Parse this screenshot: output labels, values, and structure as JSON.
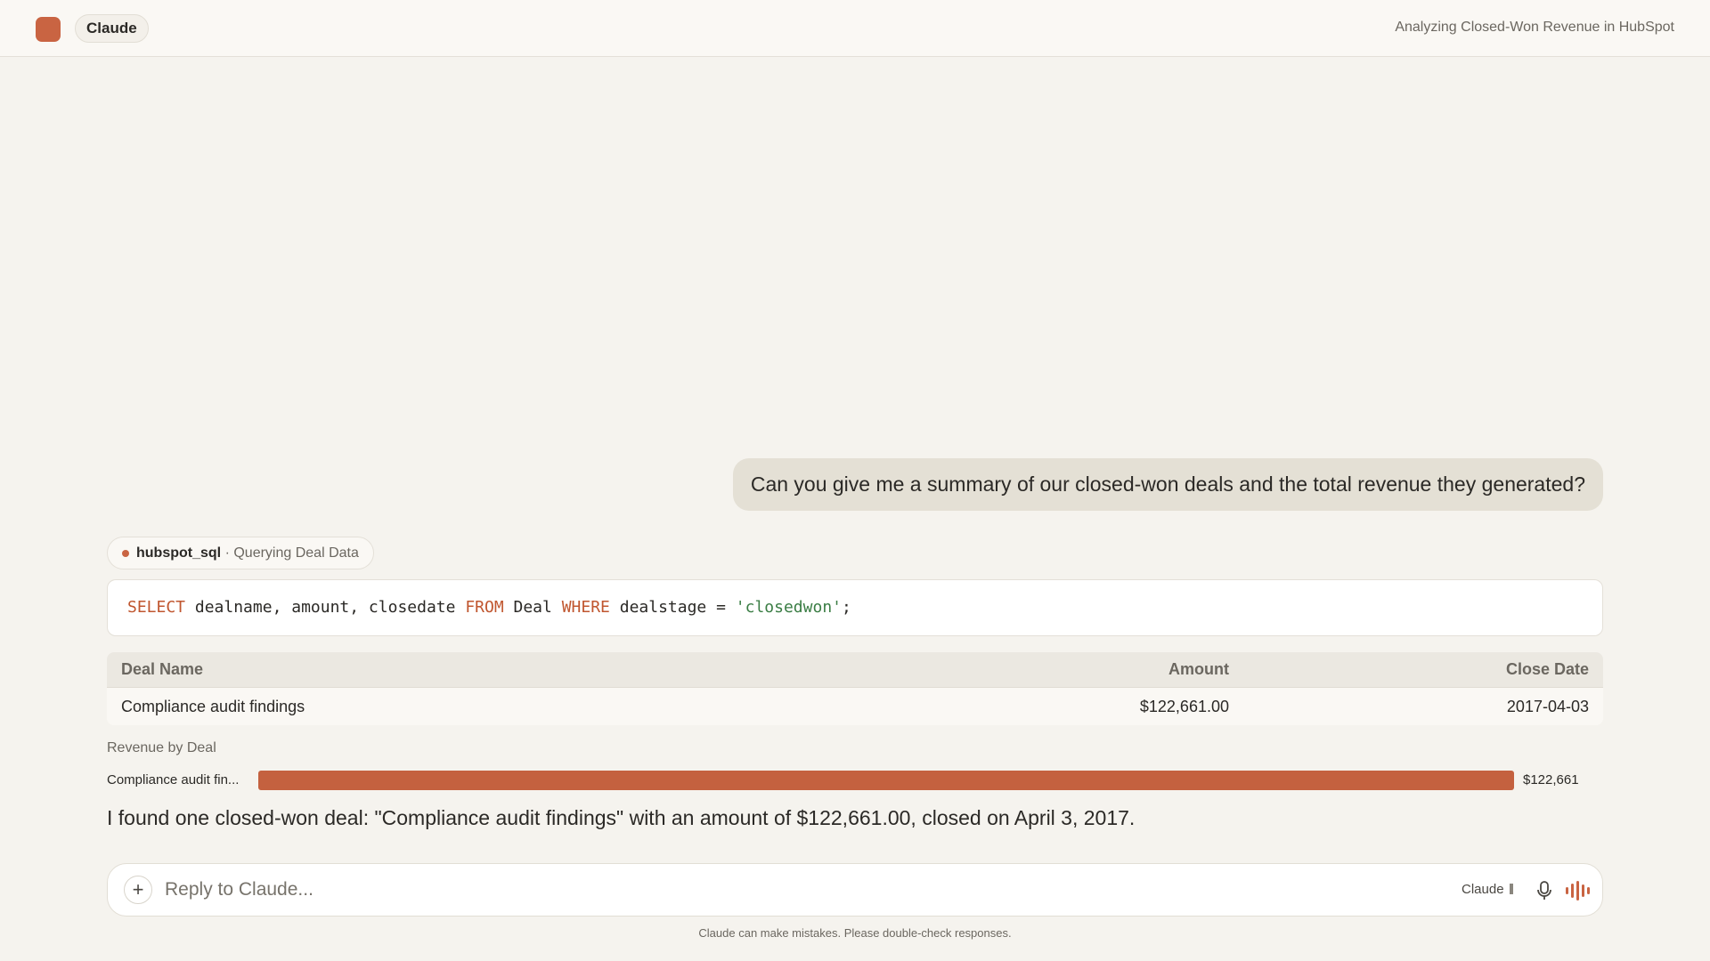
{
  "header": {
    "app_name": "Claude",
    "chat_title": "Analyzing Closed-Won Revenue in HubSpot"
  },
  "user_message": "Can you give me a summary of our closed-won deals and the total revenue they generated?",
  "tool_call": {
    "name": "hubspot_sql",
    "separator": "·",
    "status": "Querying Deal Data"
  },
  "query": {
    "kw_select": "SELECT",
    "cols": " dealname, amount, closedate ",
    "kw_from": "FROM",
    "table": " Deal ",
    "kw_where": "WHERE",
    "cond": " dealstage = ",
    "value": "'closedwon'",
    "end": ";"
  },
  "results": {
    "columns": [
      "Deal Name",
      "Amount",
      "Close Date"
    ],
    "rows": [
      [
        "Compliance audit findings",
        "$122,661.00",
        "2017-04-03"
      ]
    ]
  },
  "chart_data": {
    "type": "bar",
    "title": "Revenue by Deal",
    "categories": [
      "Compliance audit fin..."
    ],
    "values": [
      122661
    ],
    "value_labels": [
      "$122,661"
    ],
    "orientation": "horizontal",
    "color": "#c4613f"
  },
  "answer": "I found one closed-won deal: \"Compliance audit findings\" with an amount of $122,661.00, closed on April 3, 2017.",
  "composer": {
    "placeholder": "Reply to Claude...",
    "plus_label": "+",
    "model": "Claude"
  },
  "disclaimer": "Claude can make mistakes. Please double-check responses.",
  "colors": {
    "accent": "#c96442",
    "keyword": "#c0562f",
    "string": "#3a7d44"
  },
  "icons": {
    "logo": "claude-logo-icon",
    "plus": "plus-icon",
    "mic": "microphone-icon",
    "voice": "voice-waveform-icon"
  }
}
